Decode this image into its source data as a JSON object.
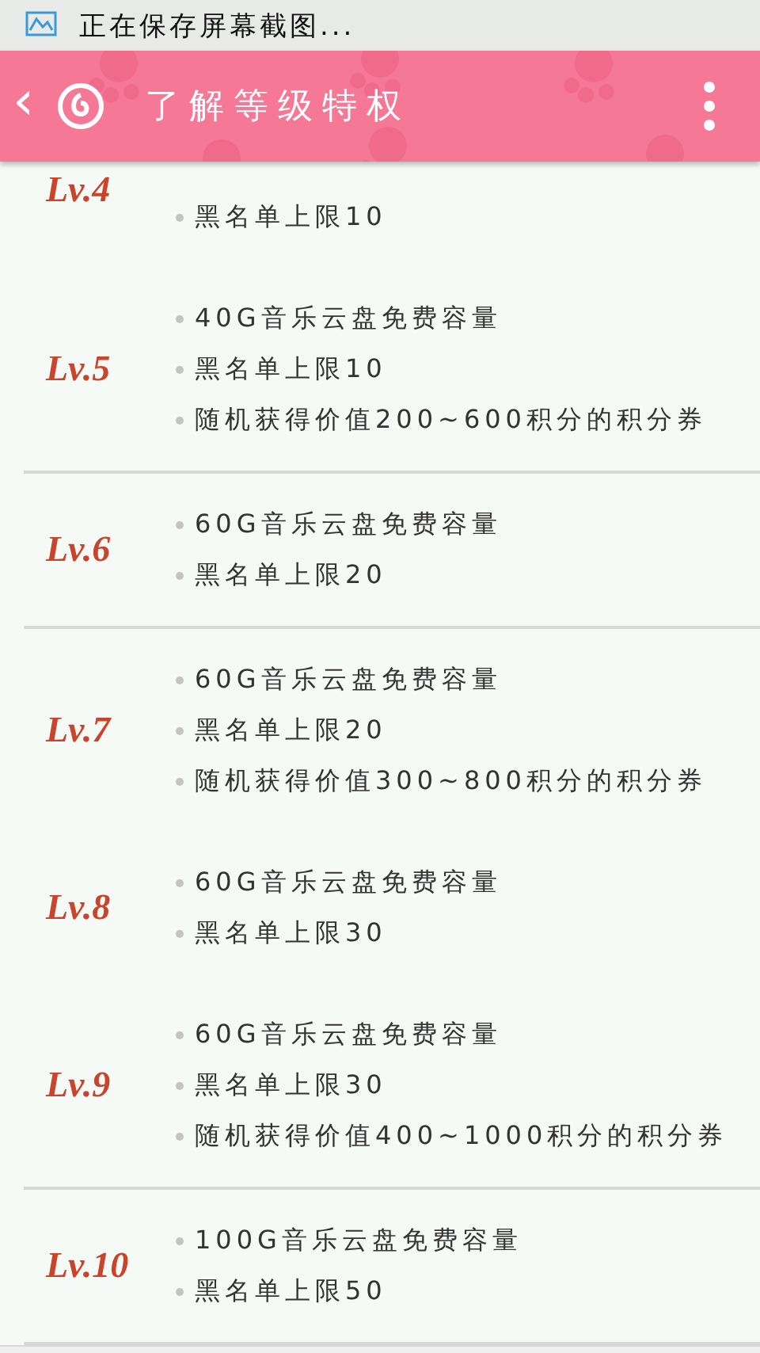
{
  "status_bar": {
    "text": "正在保存屏幕截图..."
  },
  "header": {
    "back": "‹",
    "title": "了解等级特权"
  },
  "levels": [
    {
      "label": "Lv.4",
      "items": [
        "黑名单上限10"
      ],
      "divider": false
    },
    {
      "label": "Lv.5",
      "items": [
        "40G音乐云盘免费容量",
        "黑名单上限10",
        "随机获得价值200~600积分的积分券"
      ],
      "divider": true
    },
    {
      "label": "Lv.6",
      "items": [
        "60G音乐云盘免费容量",
        "黑名单上限20"
      ],
      "divider": true
    },
    {
      "label": "Lv.7",
      "items": [
        "60G音乐云盘免费容量",
        "黑名单上限20",
        "随机获得价值300~800积分的积分券"
      ],
      "divider": false
    },
    {
      "label": "Lv.8",
      "items": [
        "60G音乐云盘免费容量",
        "黑名单上限30"
      ],
      "divider": false
    },
    {
      "label": "Lv.9",
      "items": [
        "60G音乐云盘免费容量",
        "黑名单上限30",
        "随机获得价值400~1000积分的积分券"
      ],
      "divider": true
    },
    {
      "label": "Lv.10",
      "items": [
        "100G音乐云盘免费容量",
        "黑名单上限50"
      ],
      "divider": true
    }
  ]
}
